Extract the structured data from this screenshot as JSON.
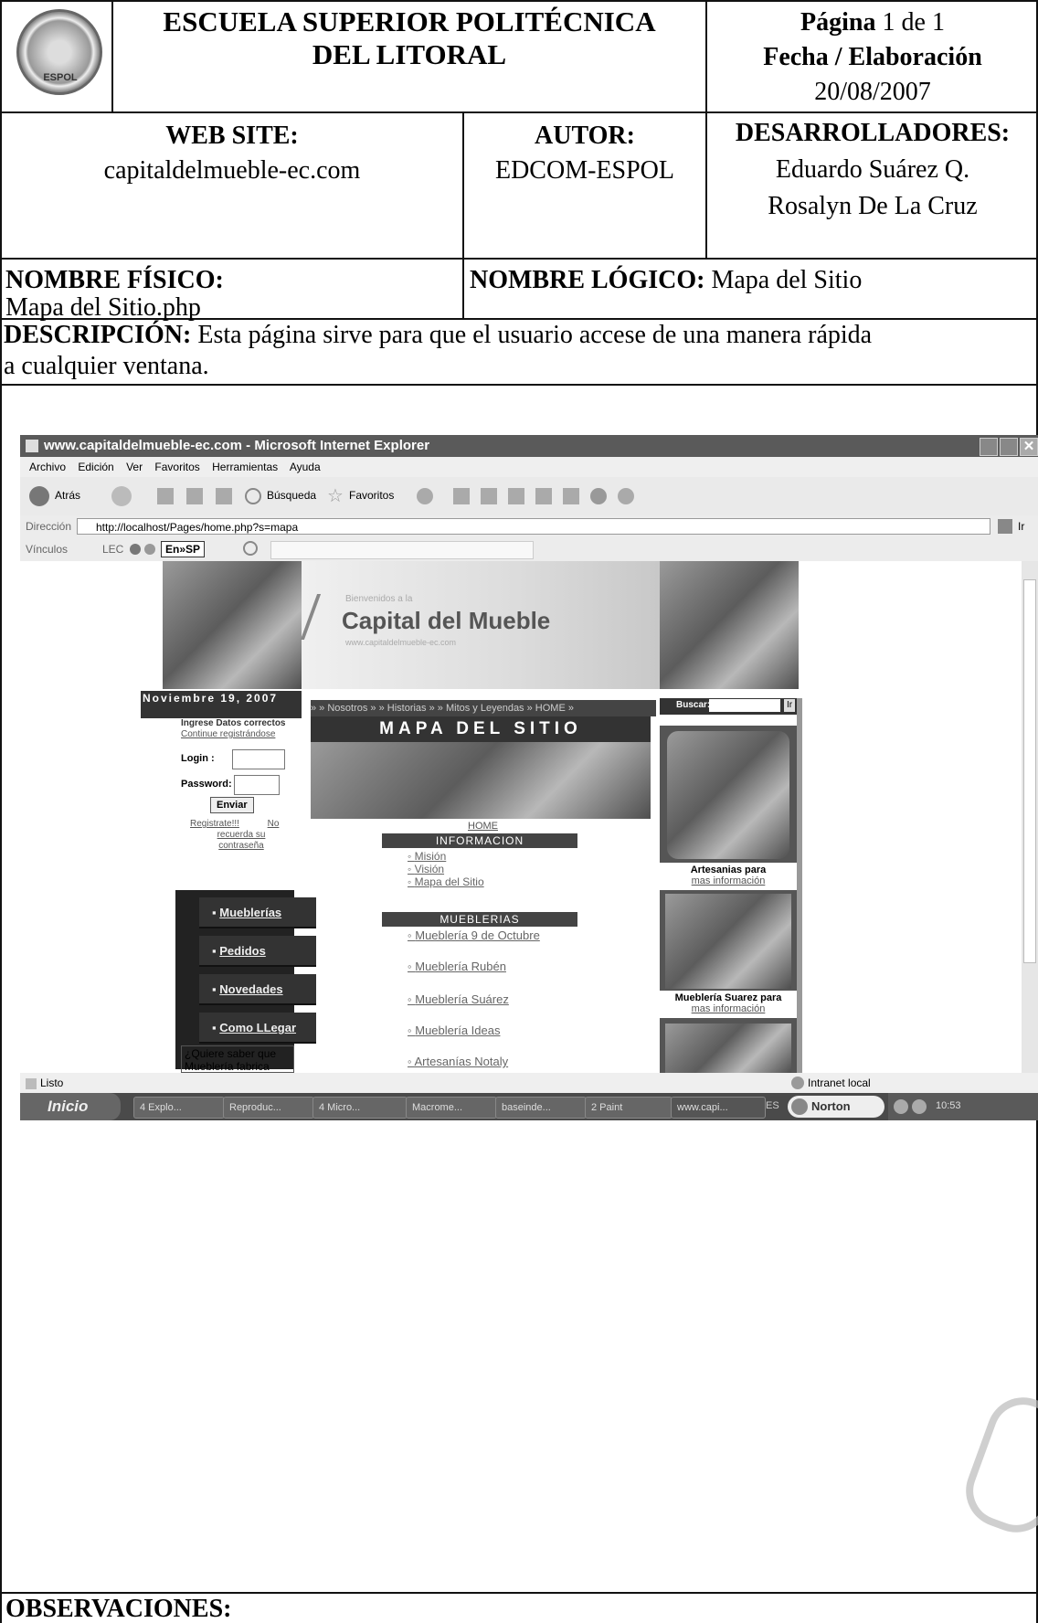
{
  "header": {
    "institution_line1": "ESCUELA SUPERIOR POLITÉCNICA",
    "institution_line2": "DEL LITORAL",
    "page_label": "Página",
    "page_value": "1 de 1",
    "date_label": "Fecha / Elaboración",
    "date_value": "20/08/2007",
    "logo_text": "ESPOL"
  },
  "info": {
    "website_label": "WEB SITE:",
    "website_value": "capitaldelmueble-ec.com",
    "author_label": "AUTOR:",
    "author_value": "EDCOM-ESPOL",
    "devs_label": "DESARROLLADORES:",
    "dev1": "Eduardo Suárez Q.",
    "dev2": "Rosalyn De La Cruz",
    "physical_label": "NOMBRE FÍSICO:",
    "physical_value": "Mapa del Sitio.php",
    "logical_label": "NOMBRE LÓGICO:",
    "logical_value": "Mapa del Sitio",
    "description_label": "DESCRIPCIÓN:",
    "description_line1": "Esta página sirve para que el usuario accese de una manera rápida",
    "description_line2": "a cualquier ventana.",
    "observations_label": "OBSERVACIONES:"
  },
  "browser": {
    "title": "www.capitaldelmueble-ec.com - Microsoft Internet Explorer",
    "menu": [
      "Archivo",
      "Edición",
      "Ver",
      "Favoritos",
      "Herramientas",
      "Ayuda"
    ],
    "back_label": "Atrás",
    "search_label": "Búsqueda",
    "favorites_label": "Favoritos",
    "address_label": "Dirección",
    "address_value": "http://localhost/Pages/home.php?s=mapa",
    "go_label": "Ir",
    "links_label": "Vínculos",
    "lec_label": "LEC",
    "translate_label": "En»SP",
    "status_text": "Listo",
    "zone_text": "Intranet local",
    "start_label": "Inicio",
    "tasks": [
      "4 Explo...",
      "Reproduc...",
      "4 Micro...",
      "Macrome...",
      "baseinde...",
      "2 Paint",
      "www.capi..."
    ],
    "lang": "ES",
    "norton": "Norton",
    "clock": "10:53"
  },
  "site": {
    "welcome": "Bienvenidos a la",
    "brand": "Capital del Mueble",
    "brand_url": "www.capitaldelmueble-ec.com",
    "date": "Noviembre 19, 2007",
    "login_title": "Ingrese Datos correctos",
    "login_sub": "Continue registrándose",
    "login_label": "Login :",
    "password_label": "Password:",
    "submit_label": "Enviar",
    "register_link": "Registrate!!!",
    "forgot_link": "No recuerda su contraseña",
    "breadcrumb": "» » Nosotros » » Historias » » Mitos y Leyendas » HOME »",
    "search_label": "Buscar:",
    "search_button": "Ir",
    "heading": "MAPA DEL SITIO",
    "home_link": "HOME",
    "info_section": "INFORMACION",
    "info_links": [
      "Misión",
      "Visión",
      "Mapa del Sitio"
    ],
    "muebles_section": "MUEBLERIAS",
    "mueble_links": [
      "Mueblería 9 de Octubre",
      "Mueblería Rubén",
      "Mueblería Suárez",
      "Mueblería Ideas",
      "Artesanías Notaly"
    ],
    "nav": [
      "Mueblerías",
      "Pedidos",
      "Novedades",
      "Como LLegar"
    ],
    "question": "¿Quiere saber que Mueblería fabrica",
    "ad1_title": "Artesanias para",
    "ad1_link": "mas información",
    "ad2_title": "Mueblería Suarez para",
    "ad2_link": "mas información"
  }
}
